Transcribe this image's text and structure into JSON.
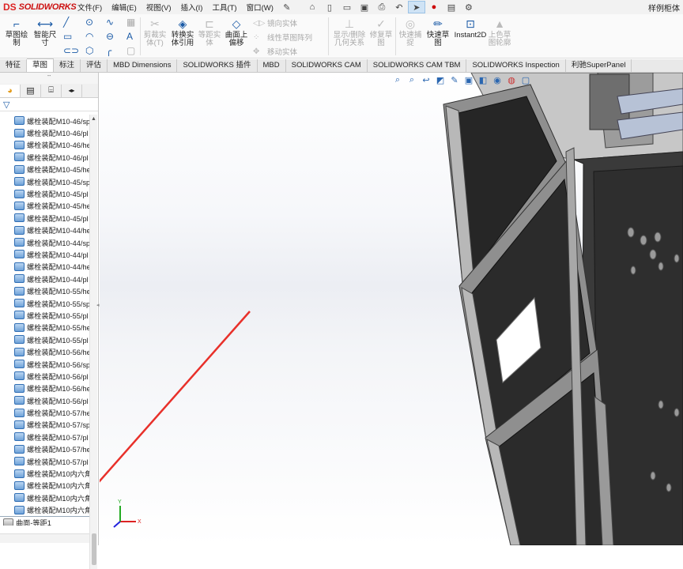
{
  "app": {
    "logo_mark": "DS",
    "logo_text": "SOLIDWORKS",
    "doc_title": "样例柜体"
  },
  "menu": [
    "文件(F)",
    "编辑(E)",
    "视图(V)",
    "插入(I)",
    "工具(T)",
    "窗口(W)"
  ],
  "ribbon": {
    "sketch": "草图绘制",
    "smart_dim": "智能尺寸",
    "cut_solid": "剪裁实体(T)",
    "convert": "转换实体引用",
    "offset": "等距实体",
    "offset_surface": "曲面上偏移",
    "mirror": "镜向实体",
    "linear_pattern": "线性草图阵列",
    "move": "移动实体",
    "display_delete": "显示/删除几何关系",
    "repair": "修复草图",
    "quick_snap": "快速捕捉",
    "rapid_sketch": "快速草图",
    "instant2d": "Instant2D",
    "shaded_sketch": "上色草图轮廓"
  },
  "tabs": [
    "特征",
    "草图",
    "标注",
    "评估",
    "MBD Dimensions",
    "SOLIDWORKS 插件",
    "MBD",
    "SOLIDWORKS CAM",
    "SOLIDWORKS CAM TBM",
    "SOLIDWORKS Inspection",
    "利驰SuperPanel"
  ],
  "active_tab": "草图",
  "tree": [
    "螺栓装配M10-46/sp",
    "螺栓装配M10-46/pl",
    "螺栓装配M10-46/he",
    "螺栓装配M10-46/pl",
    "螺栓装配M10-45/he",
    "螺栓装配M10-45/sp",
    "螺栓装配M10-45/pl",
    "螺栓装配M10-45/he",
    "螺栓装配M10-45/pl",
    "螺栓装配M10-44/he",
    "螺栓装配M10-44/sp",
    "螺栓装配M10-44/pl",
    "螺栓装配M10-44/he",
    "螺栓装配M10-44/pl",
    "螺栓装配M10-55/he",
    "螺栓装配M10-55/sp",
    "螺栓装配M10-55/pl",
    "螺栓装配M10-55/he",
    "螺栓装配M10-55/pl",
    "螺栓装配M10-56/he",
    "螺栓装配M10-56/sp",
    "螺栓装配M10-56/pl",
    "螺栓装配M10-56/he",
    "螺栓装配M10-56/pl",
    "螺栓装配M10-57/he",
    "螺栓装配M10-57/sp",
    "螺栓装配M10-57/pl",
    "螺栓装配M10-57/he",
    "螺栓装配M10-57/pl",
    "螺栓装配M10内六角",
    "螺栓装配M10内六角",
    "螺栓装配M10内六角",
    "螺栓装配M10内六角"
  ],
  "tree_last": "曲面-等距1",
  "triad": {
    "x": "X",
    "y": "Y"
  },
  "colors": {
    "accent": "#1a5aa6",
    "arrow": "#e8302a",
    "cabinet_frame": "#8a8a8a",
    "panel_dark": "#2e2e2e"
  }
}
